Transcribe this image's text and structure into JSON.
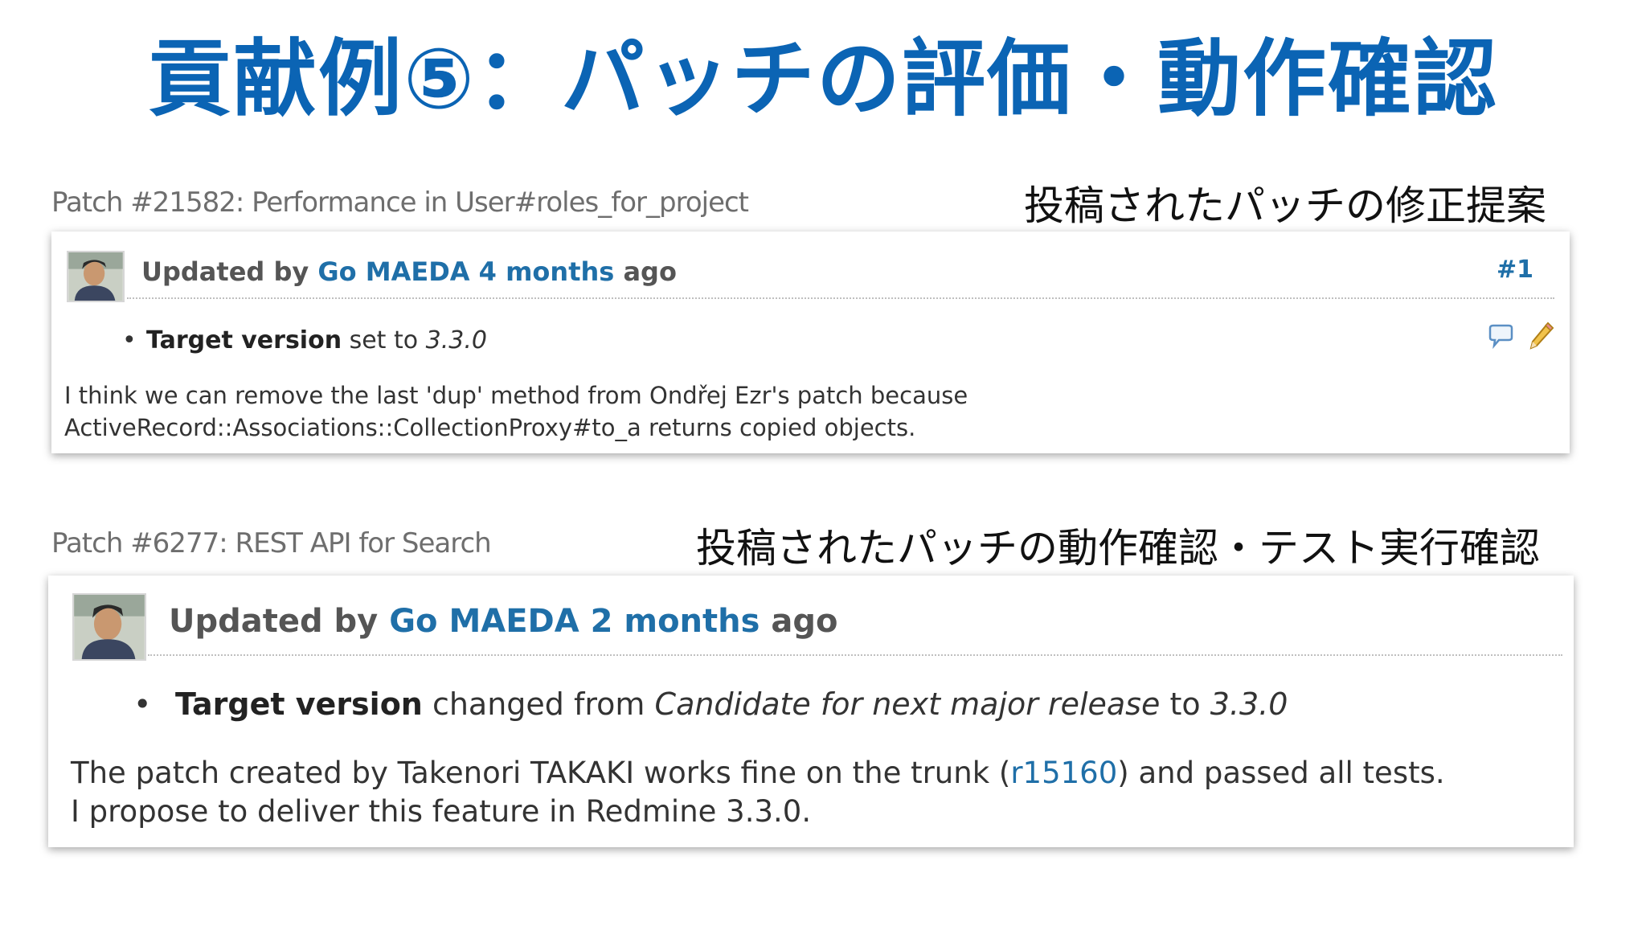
{
  "slide": {
    "title": "貢献例⑤：パッチの評価・動作確認"
  },
  "patches": [
    {
      "title": "Patch #21582: Performance in User#roles_for_project",
      "caption": "投稿されたパッチの修正提案",
      "journal": {
        "updated_by_prefix": "Updated by",
        "author": "Go MAEDA",
        "age": "4 months",
        "age_suffix": "ago",
        "number": "#1",
        "detail": {
          "field": "Target version",
          "action": "set to",
          "new_value": "3.3.0"
        },
        "note_lines": [
          "I think we can remove the last 'dup' method from Ondřej Ezr's patch because",
          "ActiveRecord::Associations::CollectionProxy#to_a returns copied objects."
        ],
        "icons": [
          "comment-icon",
          "edit-pencil-icon"
        ]
      }
    },
    {
      "title": "Patch #6277: REST API for Search",
      "caption": "投稿されたパッチの動作確認・テスト実行確認",
      "journal": {
        "updated_by_prefix": "Updated by",
        "author": "Go MAEDA",
        "age": "2 months",
        "age_suffix": "ago",
        "detail": {
          "field": "Target version",
          "action": "changed from",
          "old_value": "Candidate for next major release",
          "to_word": "to",
          "new_value": "3.3.0"
        },
        "note_line1_before": "The patch created by Takenori TAKAKI works fine on the trunk (",
        "note_line1_link": "r15160",
        "note_line1_after": ") and passed all tests.",
        "note_line2": "I propose to deliver this feature in Redmine 3.3.0."
      }
    }
  ],
  "colors": {
    "title": "#0b64b4",
    "link": "#1f6fa8",
    "patch_title": "#6e6e6e"
  }
}
